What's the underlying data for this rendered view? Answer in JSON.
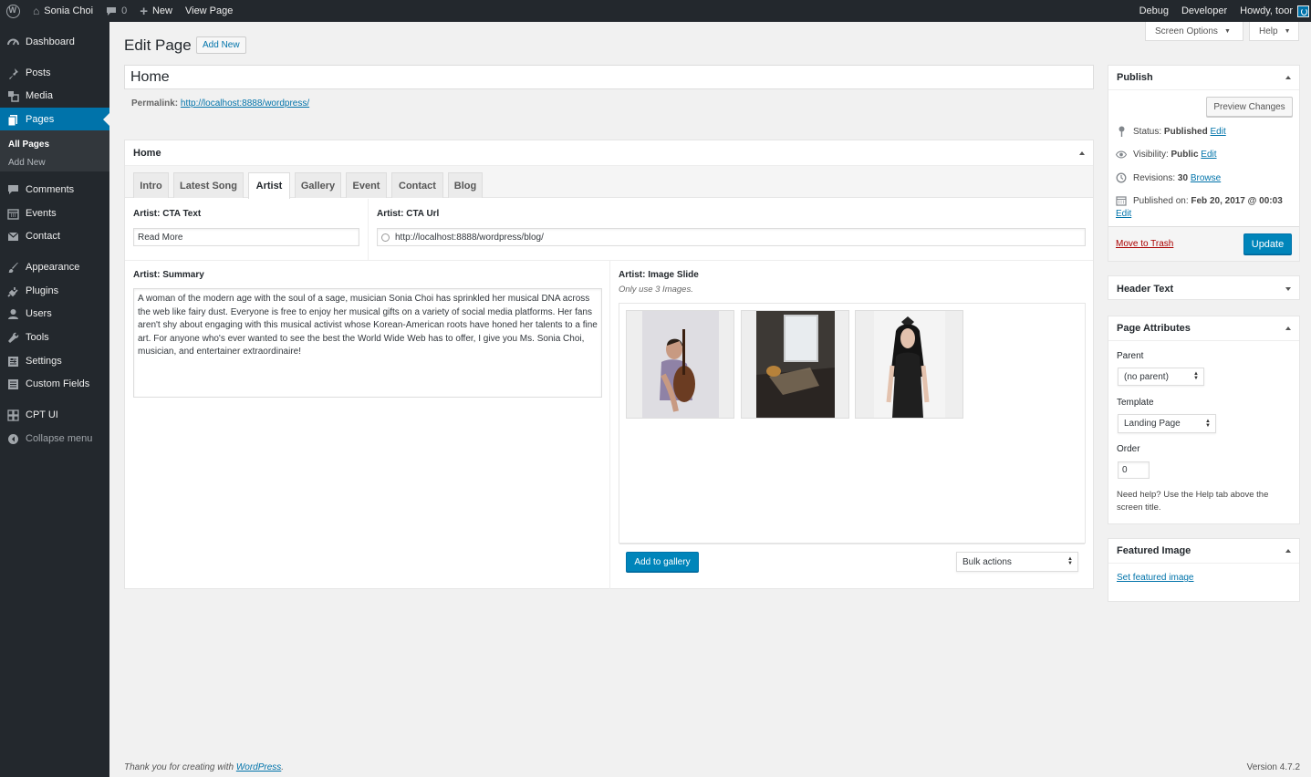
{
  "adminbar": {
    "site_name": "Sonia Choi",
    "comments_count": "0",
    "new_label": "New",
    "view_page_label": "View Page",
    "debug_label": "Debug",
    "developer_label": "Developer",
    "howdy_label": "Howdy, toor"
  },
  "sidebar": {
    "items": [
      {
        "label": "Dashboard",
        "icon": "dashboard-icon"
      },
      {
        "label": "Posts",
        "icon": "pushpin-icon"
      },
      {
        "label": "Media",
        "icon": "media-icon"
      },
      {
        "label": "Pages",
        "icon": "pages-icon"
      },
      {
        "label": "Comments",
        "icon": "comments-icon"
      },
      {
        "label": "Events",
        "icon": "calendar-icon"
      },
      {
        "label": "Contact",
        "icon": "mail-icon"
      },
      {
        "label": "Appearance",
        "icon": "brush-icon"
      },
      {
        "label": "Plugins",
        "icon": "plug-icon"
      },
      {
        "label": "Users",
        "icon": "users-icon"
      },
      {
        "label": "Tools",
        "icon": "wrench-icon"
      },
      {
        "label": "Settings",
        "icon": "settings-icon"
      },
      {
        "label": "Custom Fields",
        "icon": "list-icon"
      },
      {
        "label": "CPT UI",
        "icon": "grid-icon"
      },
      {
        "label": "Collapse menu",
        "icon": "collapse-icon"
      }
    ],
    "submenu": {
      "all_pages": "All Pages",
      "add_new": "Add New"
    }
  },
  "header": {
    "title": "Edit Page",
    "add_new_label": "Add New",
    "screen_options_label": "Screen Options",
    "help_label": "Help"
  },
  "editor": {
    "title_value": "Home",
    "permalink_label": "Permalink:",
    "permalink_url": "http://localhost:8888/wordpress/"
  },
  "metabox": {
    "title": "Home",
    "tabs": [
      "Intro",
      "Latest Song",
      "Artist",
      "Gallery",
      "Event",
      "Contact",
      "Blog"
    ],
    "active_tab": "Artist",
    "cta_text_label": "Artist: CTA Text",
    "cta_text_value": "Read More",
    "cta_url_label": "Artist: CTA Url",
    "cta_url_value": "http://localhost:8888/wordpress/blog/",
    "summary_label": "Artist: Summary",
    "summary_value": "A woman of the modern age with the soul of a sage, musician Sonia Choi has sprinkled her musical DNA across the web like fairy dust. Everyone is free to enjoy her musical gifts on a variety of social media platforms. Her fans aren't shy about engaging with this musical activist whose Korean-American roots have honed her talents to a fine art. For anyone who's ever wanted to see the best the World Wide Web has to offer, I give you Ms. Sonia Choi, musician, and entertainer extraordinaire!",
    "image_slide_label": "Artist: Image Slide",
    "image_slide_hint": "Only use 3 Images.",
    "add_gallery_label": "Add to gallery",
    "bulk_actions_label": "Bulk actions"
  },
  "publish": {
    "title": "Publish",
    "preview_label": "Preview Changes",
    "status_label": "Status:",
    "status_value": "Published",
    "visibility_label": "Visibility:",
    "visibility_value": "Public",
    "revisions_label": "Revisions:",
    "revisions_value": "30",
    "browse_label": "Browse",
    "published_on_label": "Published on:",
    "published_on_value": "Feb 20, 2017 @ 00:03",
    "edit_label": "Edit",
    "trash_label": "Move to Trash",
    "update_label": "Update"
  },
  "header_text": {
    "title": "Header Text"
  },
  "page_attributes": {
    "title": "Page Attributes",
    "parent_label": "Parent",
    "parent_value": "(no parent)",
    "template_label": "Template",
    "template_value": "Landing Page",
    "order_label": "Order",
    "order_value": "0",
    "help_text": "Need help? Use the Help tab above the screen title."
  },
  "featured_image": {
    "title": "Featured Image",
    "set_label": "Set featured image"
  },
  "footer": {
    "thanks_prefix": "Thank you for creating with ",
    "wordpress_link": "WordPress",
    "thanks_suffix": ".",
    "version": "Version 4.7.2"
  },
  "colors": {
    "admin_dark": "#23282d",
    "accent_blue": "#0073aa",
    "primary_button": "#0085ba",
    "trash_red": "#a00"
  }
}
